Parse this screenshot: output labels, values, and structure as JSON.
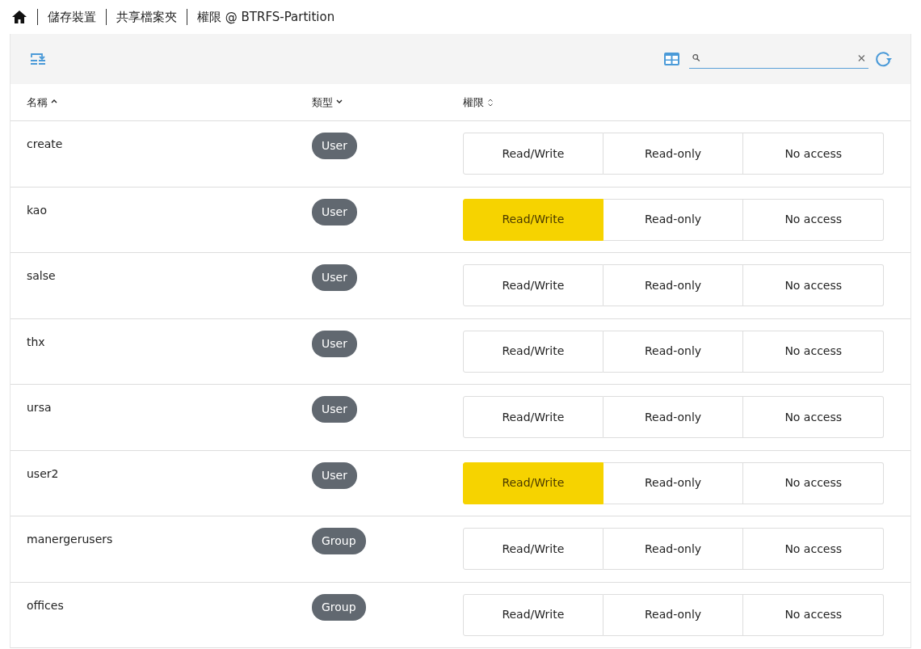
{
  "breadcrumb": [
    "儲存裝置",
    "共享檔案夾",
    "權限 @ BTRFS-Partition"
  ],
  "columns": [
    {
      "label": "名稱",
      "sorted": true,
      "ascending": true
    },
    {
      "label": "類型",
      "sorted": true,
      "ascending": false
    },
    {
      "label": "權限",
      "sorted": false
    }
  ],
  "rows": [
    {
      "name": "create",
      "type": "User",
      "permissions": [
        {
          "label": "Read/Write",
          "selected": false
        },
        {
          "label": "Read-only",
          "selected": false
        },
        {
          "label": "No access",
          "selected": false
        }
      ]
    },
    {
      "name": "kao",
      "type": "User",
      "permissions": [
        {
          "label": "Read/Write",
          "selected": true
        },
        {
          "label": "Read-only",
          "selected": false
        },
        {
          "label": "No access",
          "selected": false
        }
      ]
    },
    {
      "name": "salse",
      "type": "User",
      "permissions": [
        {
          "label": "Read/Write",
          "selected": false
        },
        {
          "label": "Read-only",
          "selected": false
        },
        {
          "label": "No access",
          "selected": false
        }
      ]
    },
    {
      "name": "thx",
      "type": "User",
      "permissions": [
        {
          "label": "Read/Write",
          "selected": false
        },
        {
          "label": "Read-only",
          "selected": false
        },
        {
          "label": "No access",
          "selected": false
        }
      ]
    },
    {
      "name": "ursa",
      "type": "User",
      "permissions": [
        {
          "label": "Read/Write",
          "selected": false
        },
        {
          "label": "Read-only",
          "selected": false
        },
        {
          "label": "No access",
          "selected": false
        }
      ]
    },
    {
      "name": "user2",
      "type": "User",
      "permissions": [
        {
          "label": "Read/Write",
          "selected": true
        },
        {
          "label": "Read-only",
          "selected": false
        },
        {
          "label": "No access",
          "selected": false
        }
      ]
    },
    {
      "name": "manergerusers",
      "type": "Group",
      "permissions": [
        {
          "label": "Read/Write",
          "selected": false
        },
        {
          "label": "Read-only",
          "selected": false
        },
        {
          "label": "No access",
          "selected": false
        }
      ]
    },
    {
      "name": "offices",
      "type": "Group",
      "permissions": [
        {
          "label": "Read/Write",
          "selected": false
        },
        {
          "label": "Read-only",
          "selected": false
        },
        {
          "label": "No access",
          "selected": false
        }
      ]
    }
  ]
}
